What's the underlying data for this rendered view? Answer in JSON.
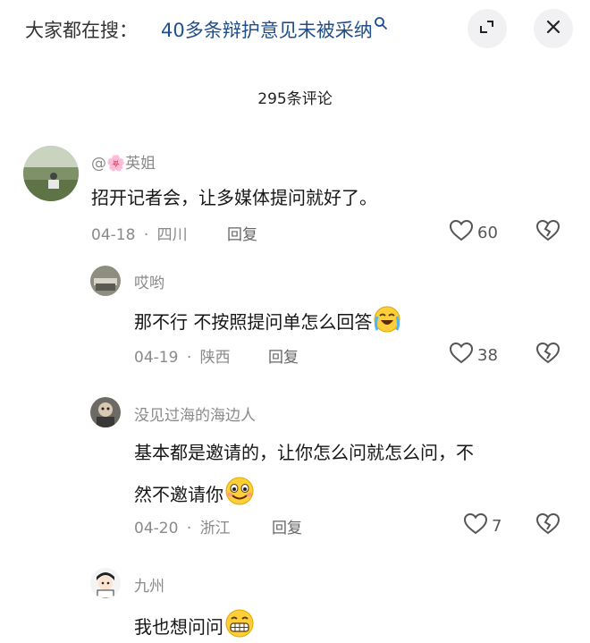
{
  "header": {
    "search_prefix": "大家都在搜：",
    "search_term": "40多条辩护意见未被采纳",
    "search_icon": "search-icon",
    "expand_icon": "expand-icon",
    "close_icon": "close-icon"
  },
  "comment_count": "295条评论",
  "comments": [
    {
      "user": "@🌸英姐",
      "text": "招开记者会，让多媒体提问就好了。",
      "date": "04-18",
      "region": "四川",
      "reply_label": "回复",
      "likes": "60"
    },
    {
      "user": "哎哟",
      "text": "那不行 不按照提问单怎么回答",
      "emoji": "crying-face",
      "date": "04-19",
      "region": "陕西",
      "reply_label": "回复",
      "likes": "38"
    },
    {
      "user": "没见过海的海边人",
      "text_line1": "基本都是邀请的，让你怎么问就怎么问，不",
      "text_line2": "然不邀请你",
      "emoji": "grinning-face",
      "date": "04-20",
      "region": "浙江",
      "reply_label": "回复",
      "likes": "7"
    },
    {
      "user": "九州",
      "text": "我也想问问",
      "emoji": "grimacing-face"
    }
  ],
  "separator": "·",
  "colors": {
    "link": "#1f4f8a",
    "meta": "#8a8a8a",
    "button_bg": "#f1f1f3"
  }
}
